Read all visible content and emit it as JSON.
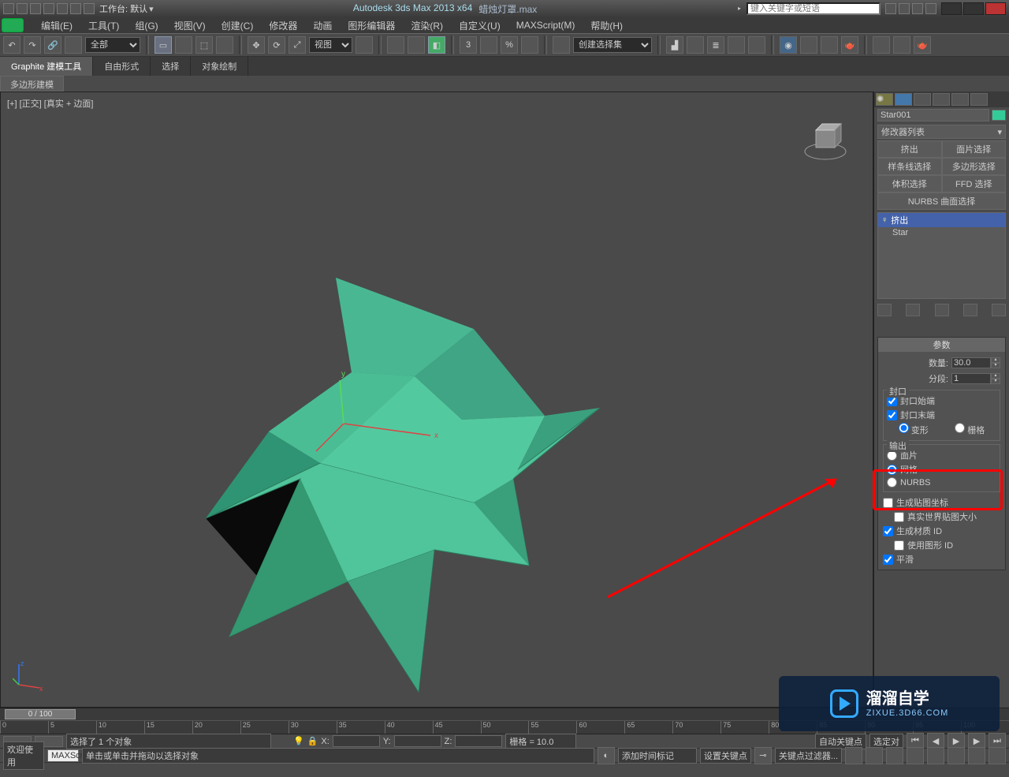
{
  "titlebar": {
    "workspace_label": "工作台: 默认",
    "product": "Autodesk 3ds Max  2013 x64",
    "filename": "蜡烛灯罩.max",
    "search_placeholder": "键入关键字或短语"
  },
  "menu": {
    "items": [
      "编辑(E)",
      "工具(T)",
      "组(G)",
      "视图(V)",
      "创建(C)",
      "修改器",
      "动画",
      "图形编辑器",
      "渲染(R)",
      "自定义(U)",
      "MAXScript(M)",
      "帮助(H)"
    ]
  },
  "toolbar": {
    "filter_all": "全部",
    "viewdrop": "视图",
    "selset": "创建选择集"
  },
  "ribbon": {
    "tabs": [
      "Graphite 建模工具",
      "自由形式",
      "选择",
      "对象绘制"
    ],
    "subtab": "多边形建模"
  },
  "viewport": {
    "label": "[+] [正交] [真实 + 边面]"
  },
  "sidepanel": {
    "object_name": "Star001",
    "modifier_list_label": "修改器列表",
    "buttons": [
      [
        "挤出",
        "面片选择"
      ],
      [
        "样条线选择",
        "多边形选择"
      ],
      [
        "体积选择",
        "FFD 选择"
      ]
    ],
    "nurbs_label": "NURBS 曲面选择",
    "stack": {
      "modifier": "挤出",
      "base": "Star"
    },
    "params": {
      "header": "参数",
      "amount_label": "数量:",
      "amount_value": "30.0",
      "segments_label": "分段:",
      "segments_value": "1",
      "cap_group": "封口",
      "cap_start": "封口始端",
      "cap_end": "封口末端",
      "morph": "变形",
      "grid": "栅格",
      "output_group": "输出",
      "patch": "面片",
      "mesh": "网格",
      "nurbs": "NURBS",
      "gen_map": "生成贴图坐标",
      "real_world": "真实世界贴图大小",
      "gen_mat": "生成材质 ID",
      "use_shape": "使用图形 ID",
      "smooth": "平滑"
    }
  },
  "timeline": {
    "slider_text": "0 / 100",
    "ticks": [
      "0",
      "5",
      "10",
      "15",
      "20",
      "25",
      "30",
      "35",
      "40",
      "45",
      "50",
      "55",
      "60",
      "65",
      "70",
      "75",
      "80",
      "85",
      "90",
      "95",
      "100"
    ]
  },
  "status": {
    "selected": "选择了 1 个对象",
    "hint": "单击或单击并拖动以选择对象",
    "welcome": "欢迎使用",
    "maxscr": "MAXScr",
    "x": "X:",
    "y": "Y:",
    "z": "Z:",
    "grid": "栅格 = 10.0",
    "add_time": "添加时间标记",
    "autokey": "自动关键点",
    "selonly": "选定对",
    "setkey": "设置关键点",
    "keyfilter": "关键点过滤器..."
  },
  "watermark": {
    "brand": "溜溜自学",
    "url": "ZIXUE.3D66.COM"
  }
}
